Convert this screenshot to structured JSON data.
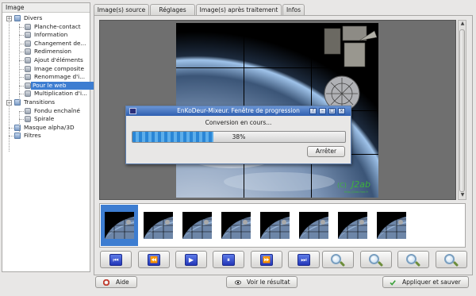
{
  "tree": {
    "header": "Image",
    "items": [
      {
        "label": "Divers",
        "level": 1,
        "expander": "−"
      },
      {
        "label": "Planche-contact",
        "level": 2
      },
      {
        "label": "Information",
        "level": 2
      },
      {
        "label": "Changement de...",
        "level": 2
      },
      {
        "label": "Redimension",
        "level": 2
      },
      {
        "label": "Ajout d'éléments",
        "level": 2
      },
      {
        "label": "Image composite",
        "level": 2
      },
      {
        "label": "Renommage d'i...",
        "level": 2
      },
      {
        "label": "Pour le web",
        "level": 2,
        "selected": true
      },
      {
        "label": "Multiplication d'i...",
        "level": 2
      },
      {
        "label": "Transitions",
        "level": 1,
        "expander": "−"
      },
      {
        "label": "Fondu enchaîné",
        "level": 2
      },
      {
        "label": "Spirale",
        "level": 2
      },
      {
        "label": "Masque alpha/3D",
        "level": 1
      },
      {
        "label": "Filtres",
        "level": 1
      }
    ]
  },
  "tabs": [
    {
      "label": "Image(s) source"
    },
    {
      "label": "Réglages"
    },
    {
      "label": "Image(s) après traitement",
      "active": true
    },
    {
      "label": "Infos"
    }
  ],
  "preview": {
    "watermark": "(C)",
    "watermark_brand": "J2ab",
    "watermark_url": "http://j2ab.free.fr"
  },
  "dialog": {
    "title": "EnKoDeur-Mixeur. Fenêtre de progression",
    "title_buttons": [
      "?",
      "–",
      "□",
      "×"
    ],
    "message": "Conversion en cours...",
    "progress_value": 38,
    "progress_label": "38%",
    "stop_label": "Arrêter"
  },
  "thumbnails": {
    "count": 8,
    "selected_index": 0
  },
  "controls": [
    {
      "name": "first-frame-icon",
      "glyph": "⏮"
    },
    {
      "name": "rewind-icon",
      "glyph": "⏪"
    },
    {
      "name": "play-icon",
      "glyph": "▶"
    },
    {
      "name": "pause-icon",
      "glyph": "⏸"
    },
    {
      "name": "fast-forward-icon",
      "glyph": "⏩"
    },
    {
      "name": "last-frame-icon",
      "glyph": "⏭"
    },
    {
      "name": "zoom-icon",
      "glyph": ""
    },
    {
      "name": "zoom-fit-icon",
      "glyph": ""
    },
    {
      "name": "zoom-in-icon",
      "glyph": ""
    },
    {
      "name": "zoom-out-icon",
      "glyph": ""
    }
  ],
  "bottom": {
    "help_label": "Aide",
    "view_result_label": "Voir le résultat",
    "apply_save_label": "Appliquer et sauver"
  },
  "colors": {
    "selection": "#3d7dd1",
    "titlebar": "#2f5fb0",
    "progress": "#2a86d6",
    "watermark": "#3db13d"
  }
}
